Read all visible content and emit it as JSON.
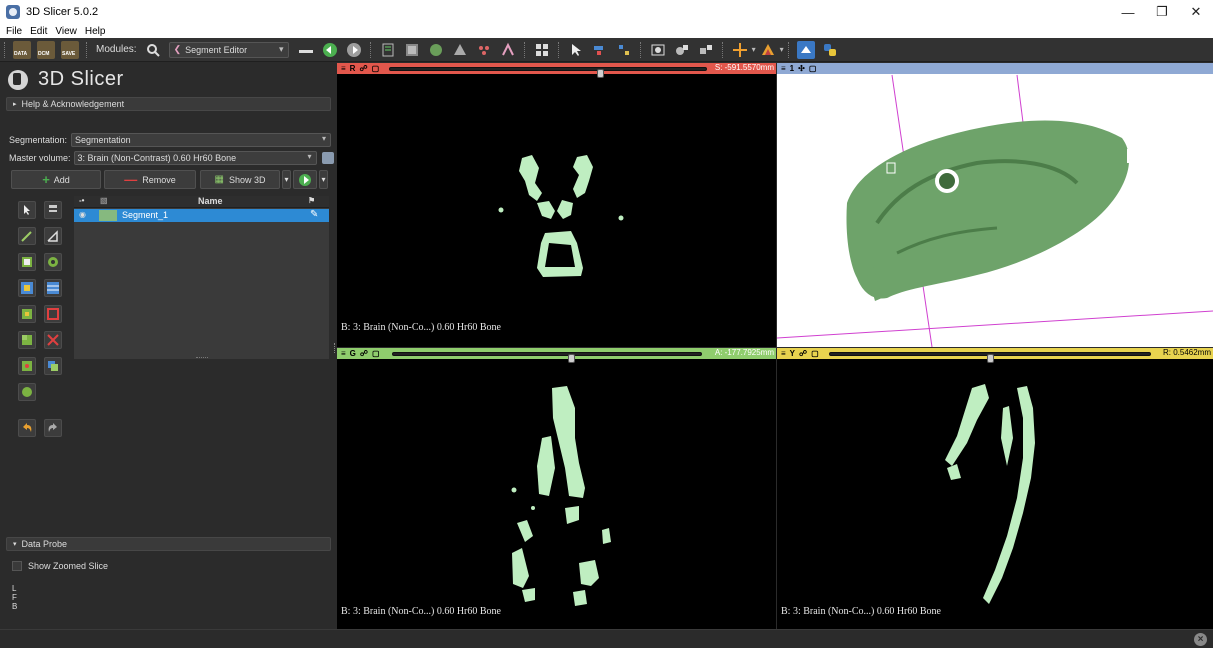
{
  "window": {
    "title": "3D Slicer 5.0.2"
  },
  "menu": {
    "items": [
      "File",
      "Edit",
      "View",
      "Help"
    ]
  },
  "toolbar": {
    "data_label": "DATA",
    "dcm_label": "DCM",
    "save_label": "SAVE",
    "modules_label": "Modules:",
    "module_selected": "Segment Editor"
  },
  "panel": {
    "logo_text": "3D Slicer",
    "help_section": "Help & Acknowledgement",
    "segmentation_label": "Segmentation:",
    "segmentation_value": "Segmentation",
    "master_label": "Master volume:",
    "master_value": "3: Brain (Non-Contrast) 0.60 Hr60 Bone",
    "add_label": "Add",
    "remove_label": "Remove",
    "show3d_label": "Show 3D",
    "table_header_name": "Name",
    "segments": [
      {
        "name": "Segment_1"
      }
    ],
    "data_probe_label": "Data Probe",
    "show_zoomed_label": "Show Zoomed Slice",
    "probe_lines": [
      "L",
      "F",
      "B"
    ]
  },
  "views": {
    "red": {
      "letter": "R",
      "offset": "S: -591.5570mm",
      "caption": "B: 3: Brain (Non-Co...) 0.60 Hr60 Bone",
      "slider": 0.67
    },
    "threed": {
      "letter": "1"
    },
    "green": {
      "letter": "G",
      "offset": "A: -177.7925mm",
      "caption": "B: 3: Brain (Non-Co...) 0.60 Hr60 Bone",
      "slider": 0.58
    },
    "yellow": {
      "letter": "Y",
      "offset": "R: 0.5462mm",
      "caption": "B: 3: Brain (Non-Co...) 0.60 Hr60 Bone",
      "slider": 0.5
    }
  },
  "colors": {
    "red_bar": "#e2574c",
    "green_bar": "#8fcd6d",
    "yellow_bar": "#e8d34f",
    "threed_bar": "#8fa9d4",
    "segment_fill": "#bfeec1",
    "skull_fill": "#6ea36a",
    "selection": "#2d8ad4"
  }
}
